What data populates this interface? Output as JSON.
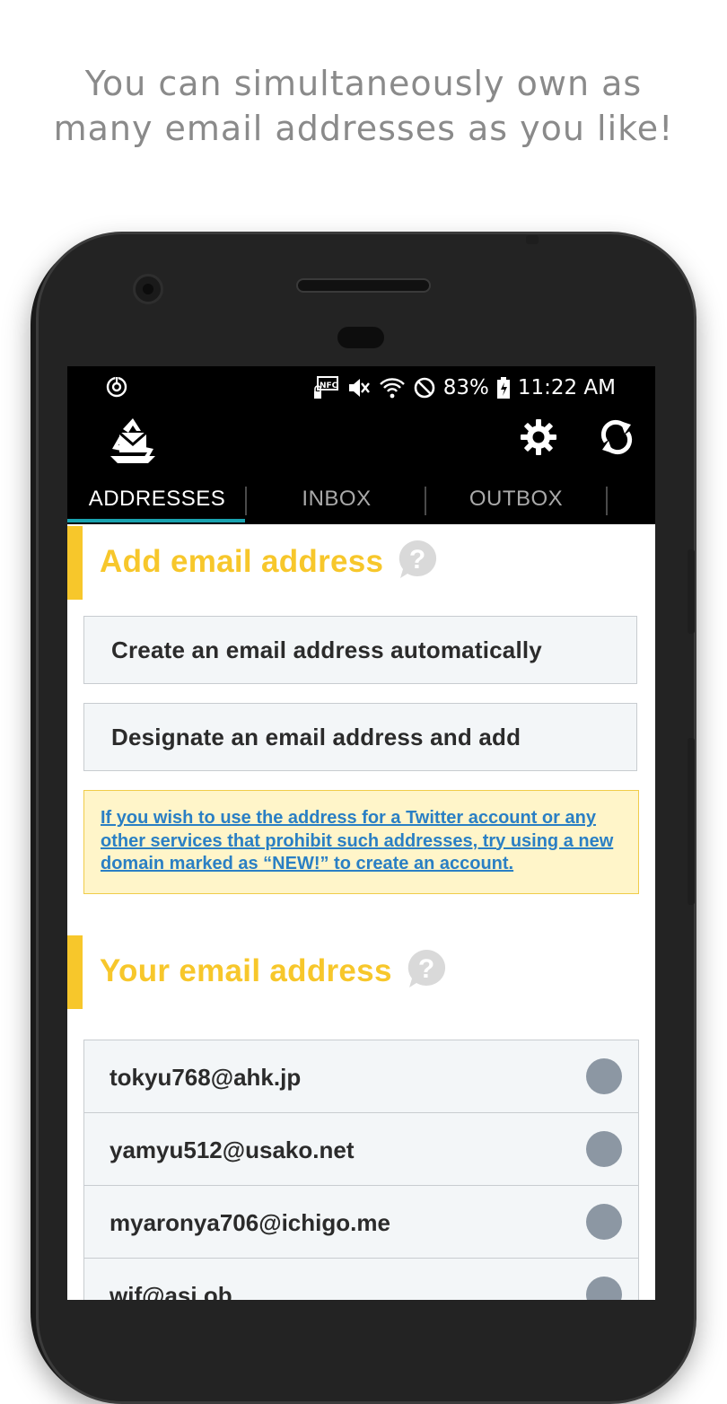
{
  "caption": {
    "line1": "You can simultaneously own as",
    "line2": "many email addresses as you like!"
  },
  "status_bar": {
    "battery": "83%",
    "time": "11:22 AM",
    "icons": [
      "sync-icon",
      "nfc-icon",
      "mute-icon",
      "wifi-icon",
      "do-not-disturb-icon",
      "battery-icon"
    ]
  },
  "app_bar": {
    "icons": [
      "app-logo-icon",
      "gear-icon",
      "refresh-icon"
    ]
  },
  "tabs": [
    {
      "label": "ADDRESSES",
      "active": true
    },
    {
      "label": "INBOX",
      "active": false
    },
    {
      "label": "OUTBOX",
      "active": false
    }
  ],
  "add_section": {
    "title": "Add email address",
    "create_auto_label": "Create an email address automatically",
    "designate_label": "Designate an email address and add",
    "notice_link": "If you wish to use the address for a Twitter account or any other services that prohibit such addresses, try using a new domain marked as “NEW!” to create an account."
  },
  "your_section": {
    "title": "Your email address",
    "addresses": [
      "tokyu768@ahk.jp",
      "yamyu512@usako.net",
      "myaronya706@ichigo.me",
      "wif@asi.ob"
    ]
  },
  "colors": {
    "accent_yellow": "#f7c72b",
    "tab_indicator": "#19a3b0",
    "link_blue": "#2a7fc4",
    "notice_bg": "#fff5c9",
    "dot_gray": "#8c97a3"
  }
}
